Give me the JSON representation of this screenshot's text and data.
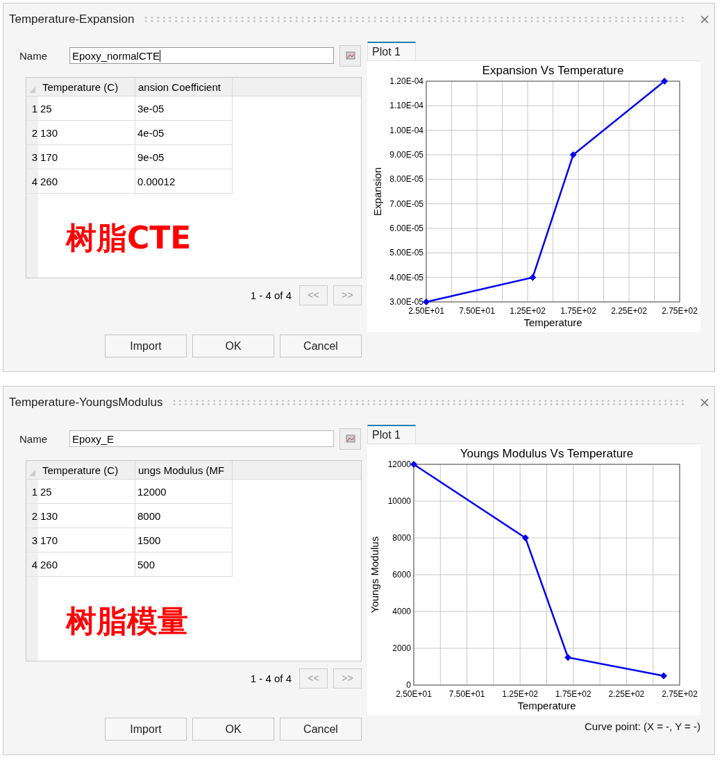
{
  "dialogs": [
    {
      "title": "Temperature-Expansion",
      "name_label": "Name",
      "name_value": "Epoxy_normalCTE",
      "name_focused": true,
      "table": {
        "columns": [
          "Temperature (C)",
          "ansion Coefficient"
        ],
        "rows": [
          {
            "index": "1",
            "cells": [
              "25",
              "3e-05"
            ]
          },
          {
            "index": "2",
            "cells": [
              "130",
              "4e-05"
            ]
          },
          {
            "index": "3",
            "cells": [
              "170",
              "9e-05"
            ]
          },
          {
            "index": "4",
            "cells": [
              "260",
              "0.00012"
            ]
          }
        ]
      },
      "annotation": "树脂CTE",
      "pagination": "1 - 4 of 4",
      "prev_button": "<<",
      "next_button": ">>",
      "buttons": [
        "Import",
        "OK",
        "Cancel"
      ],
      "tab": {
        "label": "Plot 1",
        "selected": true
      },
      "chart_data": {
        "type": "line",
        "title": "Expansion Vs Temperature",
        "xlabel": "Temperature",
        "ylabel": "Expansion",
        "x": [
          25,
          130,
          170,
          260
        ],
        "grid": true,
        "series": [
          {
            "color": "#0000ee",
            "marker": "diamond",
            "values": [
              3e-05,
              4e-05,
              9e-05,
              0.00012
            ]
          }
        ],
        "xlim": [
          25,
          275
        ],
        "ylim": [
          3e-05,
          0.00012
        ],
        "xticks": [
          {
            "value": 25,
            "label": "2.50E+01"
          },
          {
            "value": 75,
            "label": "7.50E+01"
          },
          {
            "value": 125,
            "label": "1.25E+02"
          },
          {
            "value": 175,
            "label": "1.75E+02"
          },
          {
            "value": 225,
            "label": "2.25E+02"
          },
          {
            "value": 275,
            "label": "2.75E+02"
          }
        ],
        "yticks": [
          {
            "value": 3e-05,
            "label": "3.00E-05"
          },
          {
            "value": 4e-05,
            "label": "4.00E-05"
          },
          {
            "value": 5e-05,
            "label": "5.00E-05"
          },
          {
            "value": 6e-05,
            "label": "6.00E-05"
          },
          {
            "value": 7e-05,
            "label": "7.00E-05"
          },
          {
            "value": 8e-05,
            "label": "8.00E-05"
          },
          {
            "value": 9e-05,
            "label": "9.00E-05"
          },
          {
            "value": 0.0001,
            "label": "1.00E-04"
          },
          {
            "value": 0.00011,
            "label": "1.10E-04"
          },
          {
            "value": 0.00012,
            "label": "1.20E-04"
          }
        ]
      }
    },
    {
      "title": "Temperature-YoungsModulus",
      "name_label": "Name",
      "name_value": "Epoxy_E",
      "name_focused": false,
      "table": {
        "columns": [
          "Temperature (C)",
          "ungs Modulus (MF"
        ],
        "rows": [
          {
            "index": "1",
            "cells": [
              "25",
              "12000"
            ]
          },
          {
            "index": "2",
            "cells": [
              "130",
              "8000"
            ]
          },
          {
            "index": "3",
            "cells": [
              "170",
              "1500"
            ]
          },
          {
            "index": "4",
            "cells": [
              "260",
              "500"
            ]
          }
        ]
      },
      "annotation": "树脂模量",
      "pagination": "1 - 4 of 4",
      "prev_button": "<<",
      "next_button": ">>",
      "buttons": [
        "Import",
        "OK",
        "Cancel"
      ],
      "tab": {
        "label": "Plot 1",
        "selected": true
      },
      "chart_data": {
        "type": "line",
        "title": "Youngs Modulus Vs Temperature",
        "xlabel": "Temperature",
        "ylabel": "Youngs Modulus",
        "x": [
          25,
          130,
          170,
          260
        ],
        "grid": true,
        "series": [
          {
            "color": "#0000ee",
            "marker": "diamond",
            "values": [
              12000,
              8000,
              1500,
              500
            ]
          }
        ],
        "xlim": [
          25,
          275
        ],
        "ylim": [
          0,
          12000
        ],
        "xticks": [
          {
            "value": 25,
            "label": "2.50E+01"
          },
          {
            "value": 75,
            "label": "7.50E+01"
          },
          {
            "value": 125,
            "label": "1.25E+02"
          },
          {
            "value": 175,
            "label": "1.75E+02"
          },
          {
            "value": 225,
            "label": "2.25E+02"
          },
          {
            "value": 275,
            "label": "2.75E+02"
          }
        ],
        "yticks": [
          0,
          2000,
          4000,
          6000,
          8000,
          10000,
          12000
        ]
      },
      "status": "Curve point: (X = -, Y = -)"
    }
  ]
}
